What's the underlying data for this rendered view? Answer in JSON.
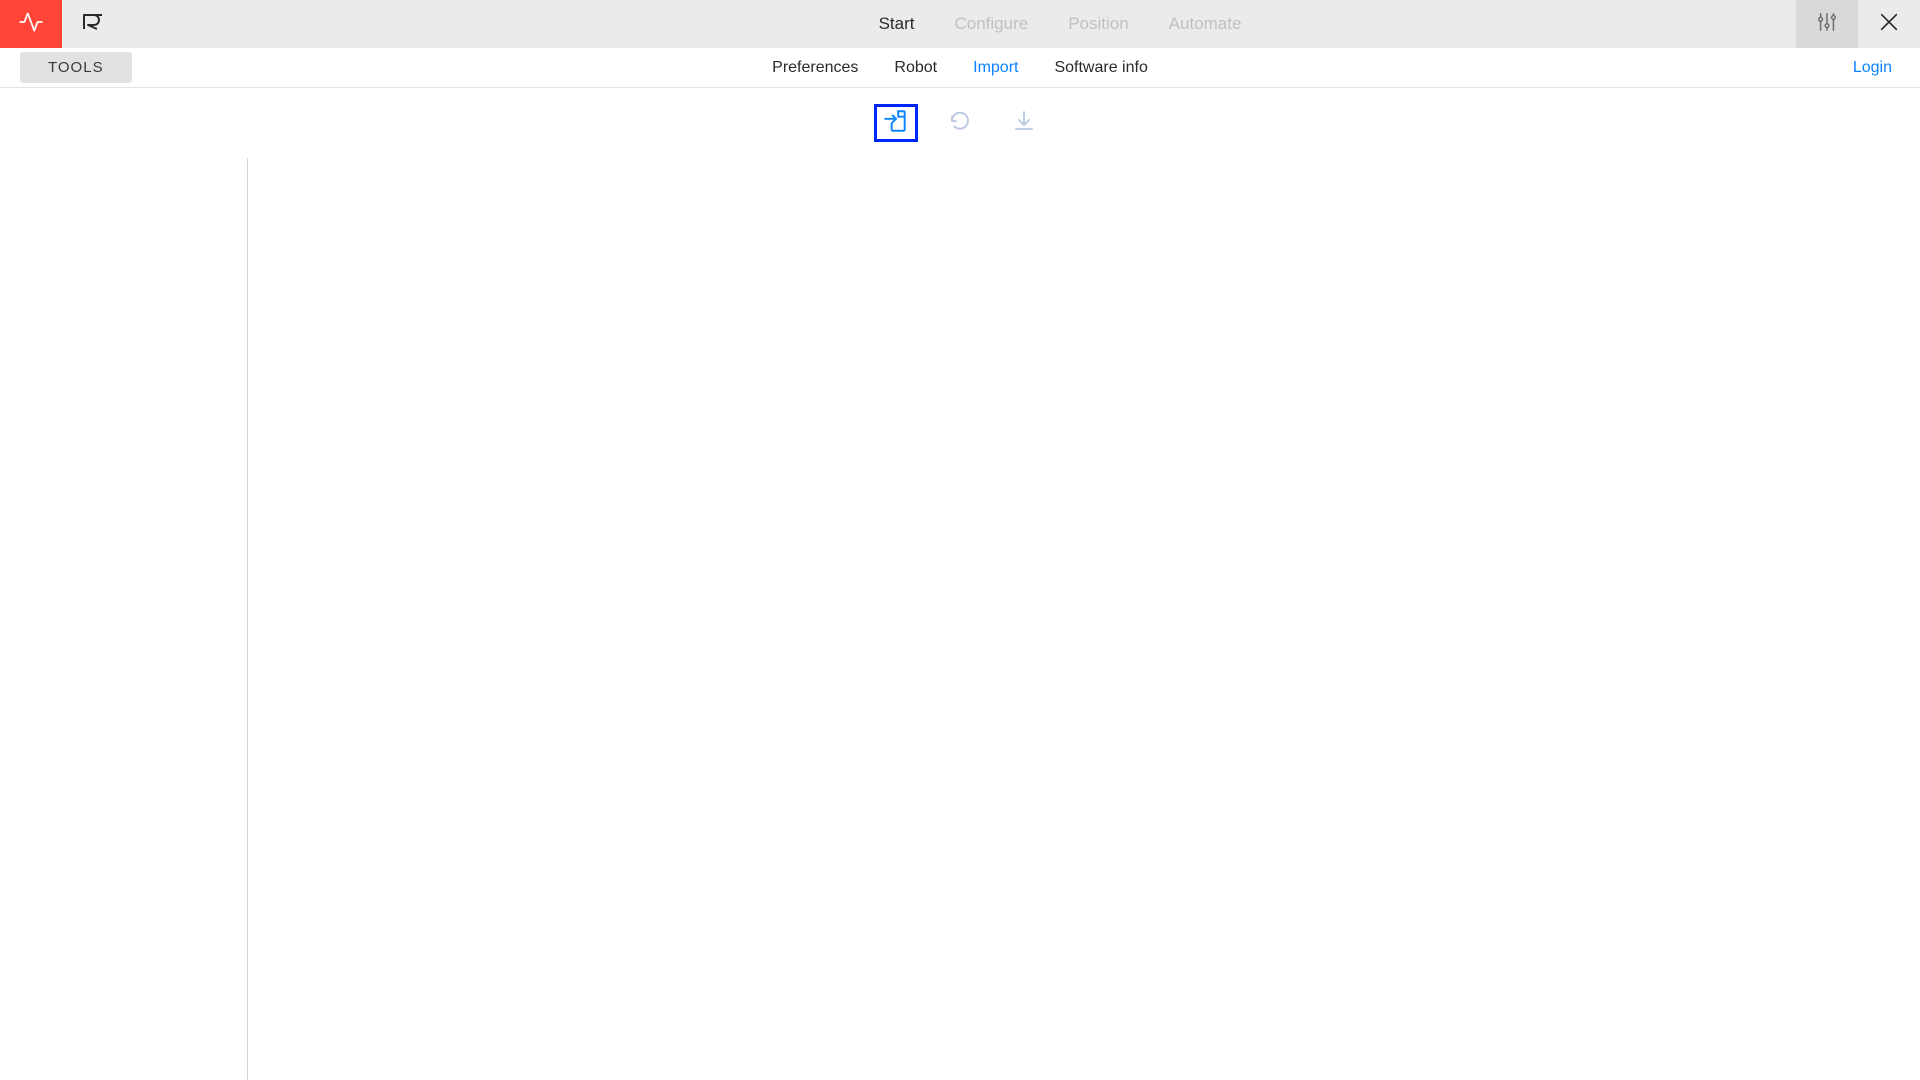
{
  "colors": {
    "accent": "#0a84ff",
    "danger": "#ff4438",
    "highlight_border": "#0026ff",
    "icon_inactive": "#b8c6e0",
    "nav_inactive": "#c0c0c0",
    "text": "#2a2a2a"
  },
  "topnav": {
    "items": [
      {
        "label": "Start",
        "active": true
      },
      {
        "label": "Configure",
        "active": false
      },
      {
        "label": "Position",
        "active": false
      },
      {
        "label": "Automate",
        "active": false
      }
    ]
  },
  "tools_chip": "TOOLS",
  "subnav": {
    "items": [
      {
        "label": "Preferences",
        "active": false
      },
      {
        "label": "Robot",
        "active": false
      },
      {
        "label": "Import",
        "active": true
      },
      {
        "label": "Software info",
        "active": false
      }
    ]
  },
  "login_label": "Login",
  "actions": {
    "import_file": "import-file-icon",
    "refresh": "refresh-icon",
    "download": "download-icon"
  }
}
